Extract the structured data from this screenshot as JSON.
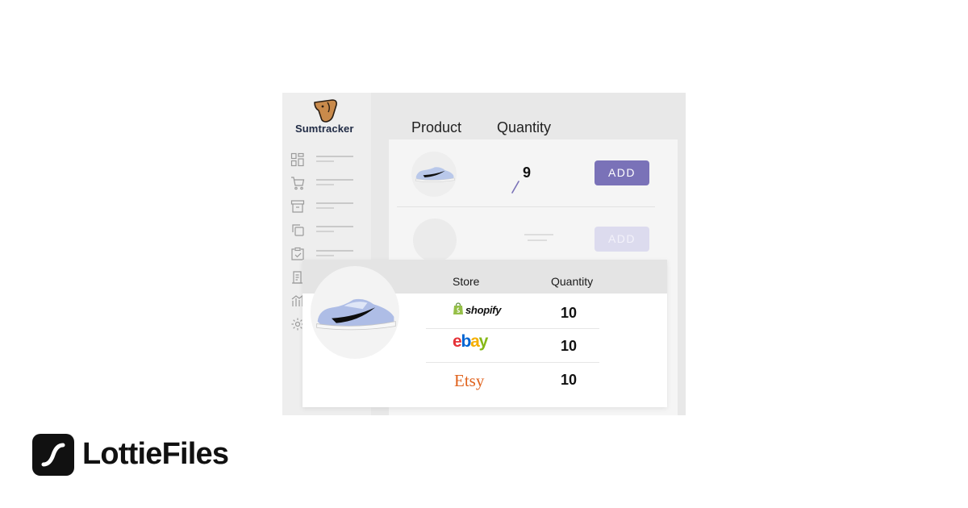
{
  "app": {
    "name": "Sumtracker",
    "logo_icon": "dog-head-icon"
  },
  "sidebar": {
    "items": [
      {
        "icon": "dashboard-icon"
      },
      {
        "icon": "cart-icon"
      },
      {
        "icon": "archive-icon"
      },
      {
        "icon": "copy-icon"
      },
      {
        "icon": "clipboard-check-icon"
      },
      {
        "icon": "document-icon"
      },
      {
        "icon": "chart-icon"
      },
      {
        "icon": "gear-icon"
      }
    ]
  },
  "product_table": {
    "headers": {
      "product": "Product",
      "quantity": "Quantity"
    },
    "rows": [
      {
        "image": "sneaker-icon",
        "quantity": "9",
        "action_label": "ADD",
        "faded": false
      },
      {
        "image": "",
        "quantity": "",
        "action_label": "ADD",
        "faded": true
      }
    ]
  },
  "store_breakdown": {
    "headers": {
      "store": "Store",
      "quantity": "Quantity"
    },
    "product_image": "sneaker-icon",
    "rows": [
      {
        "store": "shopify",
        "quantity": "10"
      },
      {
        "store": "ebay",
        "quantity": "10"
      },
      {
        "store": "Etsy",
        "quantity": "10"
      }
    ]
  },
  "colors": {
    "accent": "#7a72b8",
    "logo": "#c98a4b",
    "ebay": [
      "#e53238",
      "#0064d2",
      "#f5af02",
      "#86b817"
    ],
    "etsy": "#e0621c",
    "shopify": "#95bf47"
  },
  "footer_brand": {
    "name": "LottieFiles",
    "icon": "lottiefiles-logo-icon"
  }
}
